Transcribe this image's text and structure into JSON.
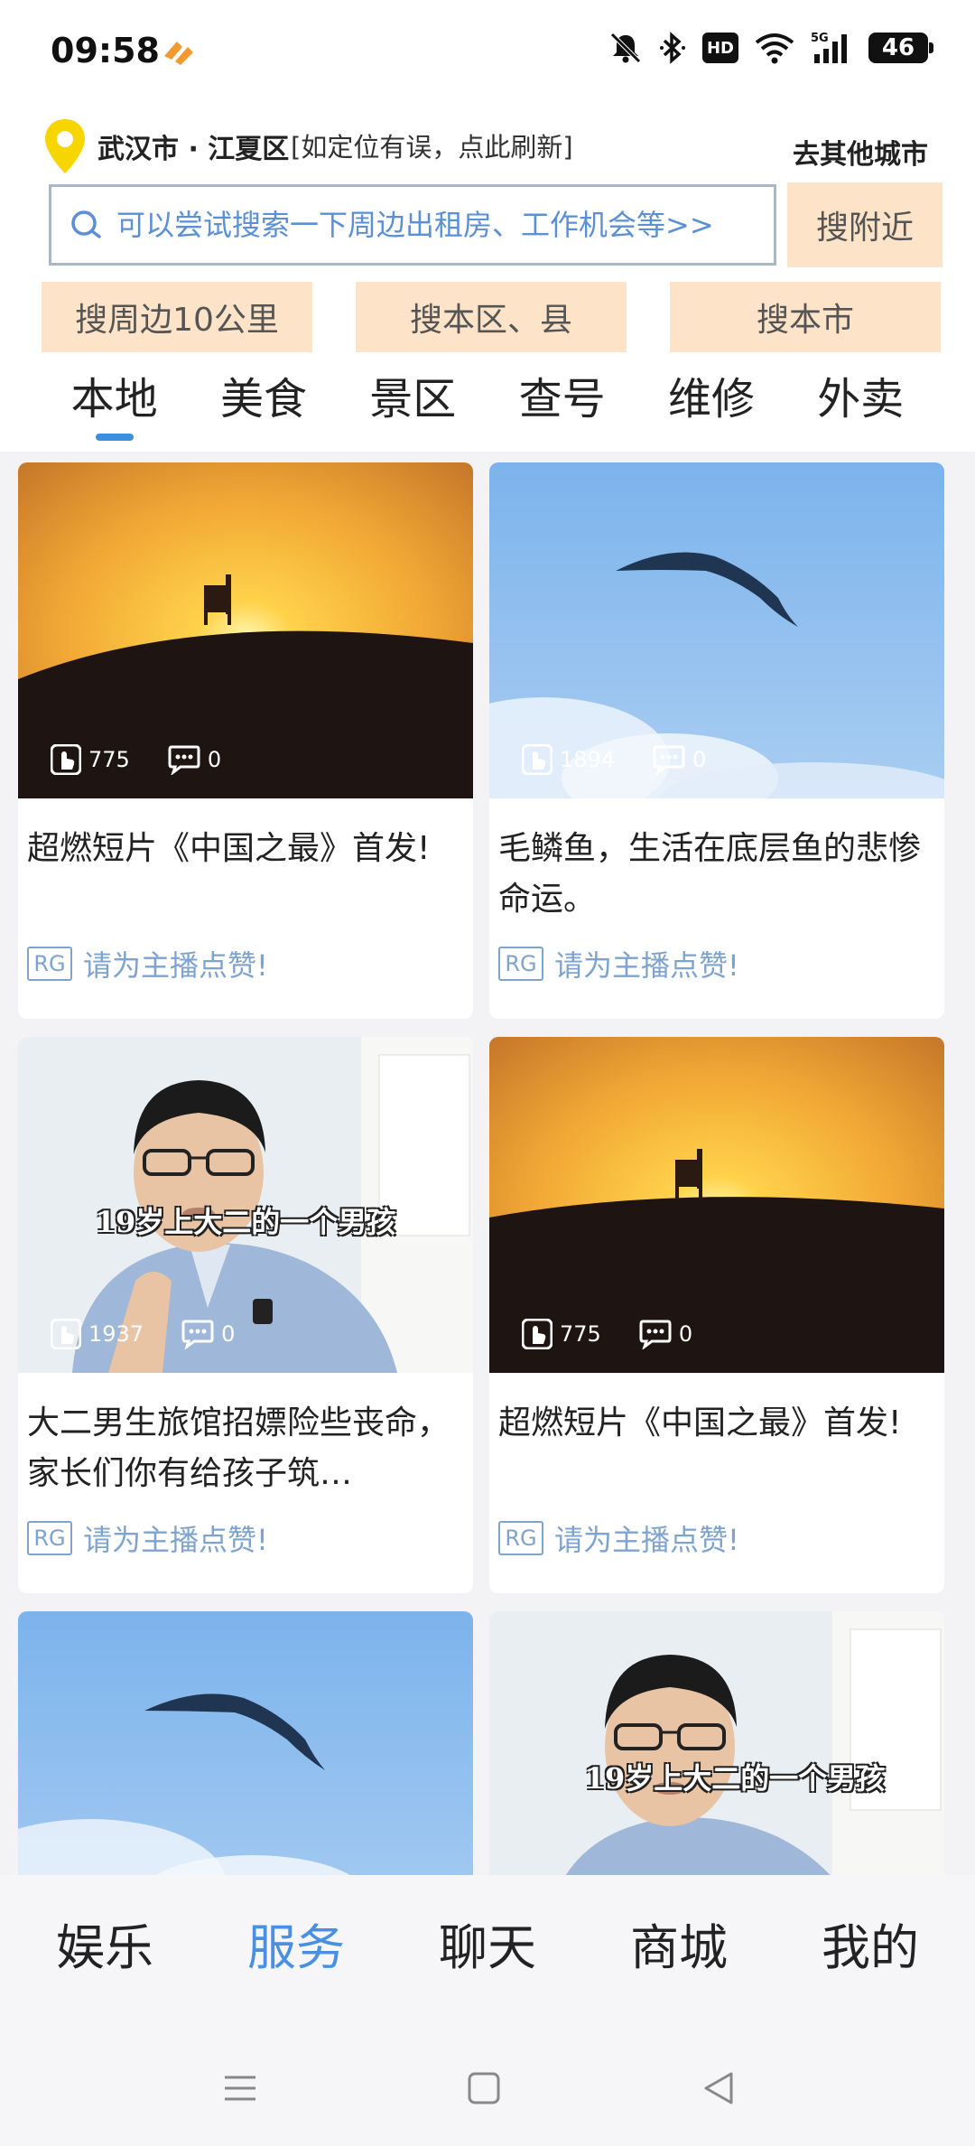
{
  "status_bar": {
    "time": "09:58",
    "battery": "46",
    "network": "5G",
    "hd": "HD"
  },
  "header": {
    "city": "武汉市 · 江夏区",
    "location_hint": "[如定位有误，点此刷新]",
    "other_city": "去其他城市",
    "search_placeholder": "可以尝试搜索一下周边出租房、工作机会等>>",
    "search_nearby": "搜附近",
    "quick_buttons": [
      "搜周边10公里",
      "搜本区、县",
      "搜本市"
    ],
    "tabs": [
      "本地",
      "美食",
      "景区",
      "查号",
      "维修",
      "外卖"
    ],
    "active_tab": "本地"
  },
  "feed": {
    "cards": [
      {
        "thumb": "sunset-chair",
        "likes": "775",
        "comments": "0",
        "title": "超燃短片《中国之最》首发!",
        "badge": "RG",
        "author": "请为主播点赞!"
      },
      {
        "thumb": "sky-bird",
        "likes": "1894",
        "comments": "0",
        "title": "毛鳞鱼，生活在底层鱼的悲惨命运。",
        "badge": "RG",
        "author": "请为主播点赞!"
      },
      {
        "thumb": "man-talking",
        "likes": "1937",
        "comments": "0",
        "title": "大二男生旅馆招嫖险些丧命，家长们你有给孩子筑…",
        "badge": "RG",
        "author": "请为主播点赞!",
        "overlay_caption": "19岁上大二的一个男孩"
      },
      {
        "thumb": "sunset-chair",
        "likes": "775",
        "comments": "0",
        "title": "超燃短片《中国之最》首发!",
        "badge": "RG",
        "author": "请为主播点赞!"
      },
      {
        "thumb": "sky-bird"
      },
      {
        "thumb": "man-talking",
        "overlay_caption": "19岁上大二的一个男孩"
      }
    ]
  },
  "bottom_nav": {
    "items": [
      "娱乐",
      "服务",
      "聊天",
      "商城",
      "我的"
    ],
    "active": "服务"
  },
  "colors": {
    "accent": "#4a90e2",
    "button_bg": "#fde3c8",
    "link": "#7fa3cf",
    "pin": "#f7d600"
  }
}
